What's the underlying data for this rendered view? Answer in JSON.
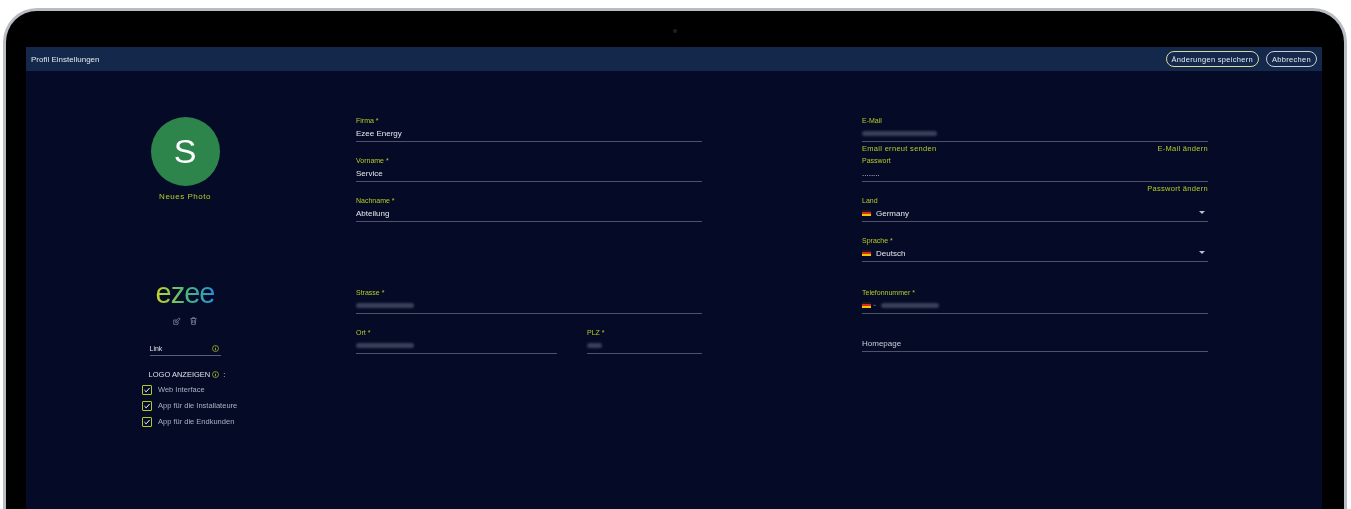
{
  "window": {
    "title": "Profil Einstellungen"
  },
  "header_buttons": [
    {
      "label": "Änderungen speichern",
      "kind": "primary"
    },
    {
      "label": "Abbrechen",
      "kind": "secondary"
    }
  ],
  "profile": {
    "avatar_letter": "S",
    "photo_link": "Neues Photo"
  },
  "logo": {
    "text": "ezee"
  },
  "link_field": {
    "placeholder": "Link"
  },
  "logo_display": {
    "title": "LOGO ANZEIGEN",
    "suffix": ":",
    "options": [
      {
        "label": "Web Interface",
        "checked": true
      },
      {
        "label": "App für die Installateure",
        "checked": true
      },
      {
        "label": "App für die Endkunden",
        "checked": true
      }
    ]
  },
  "company_form": [
    {
      "label": "Firma *",
      "kind": "text",
      "value": "Ezee Energy"
    },
    {
      "label": "Vorname *",
      "kind": "text",
      "value": "Service"
    },
    {
      "label": "Nachname *",
      "kind": "text",
      "value": "Abteilung"
    }
  ],
  "address_form": [
    {
      "label": "Strasse *",
      "kind": "redacted"
    },
    {
      "label": "Ort *",
      "kind": "redacted"
    },
    {
      "label": "PLZ *",
      "kind": "redacted"
    }
  ],
  "account_form": [
    {
      "label": "E-Mail",
      "kind": "redacted",
      "links": [
        "Email erneut senden",
        "E-Mail ändern"
      ]
    },
    {
      "label": "Passwort",
      "kind": "text",
      "value": "........",
      "links": [
        "Passwort ändern"
      ]
    },
    {
      "label": "Land",
      "kind": "select",
      "value": "Germany"
    },
    {
      "label": "Sprache *",
      "kind": "select",
      "value": "Deutsch"
    }
  ],
  "contact_form": [
    {
      "label": "Telefonnummer *",
      "kind": "phone"
    },
    {
      "kind": "placeholder",
      "placeholder": "Homepage"
    }
  ]
}
